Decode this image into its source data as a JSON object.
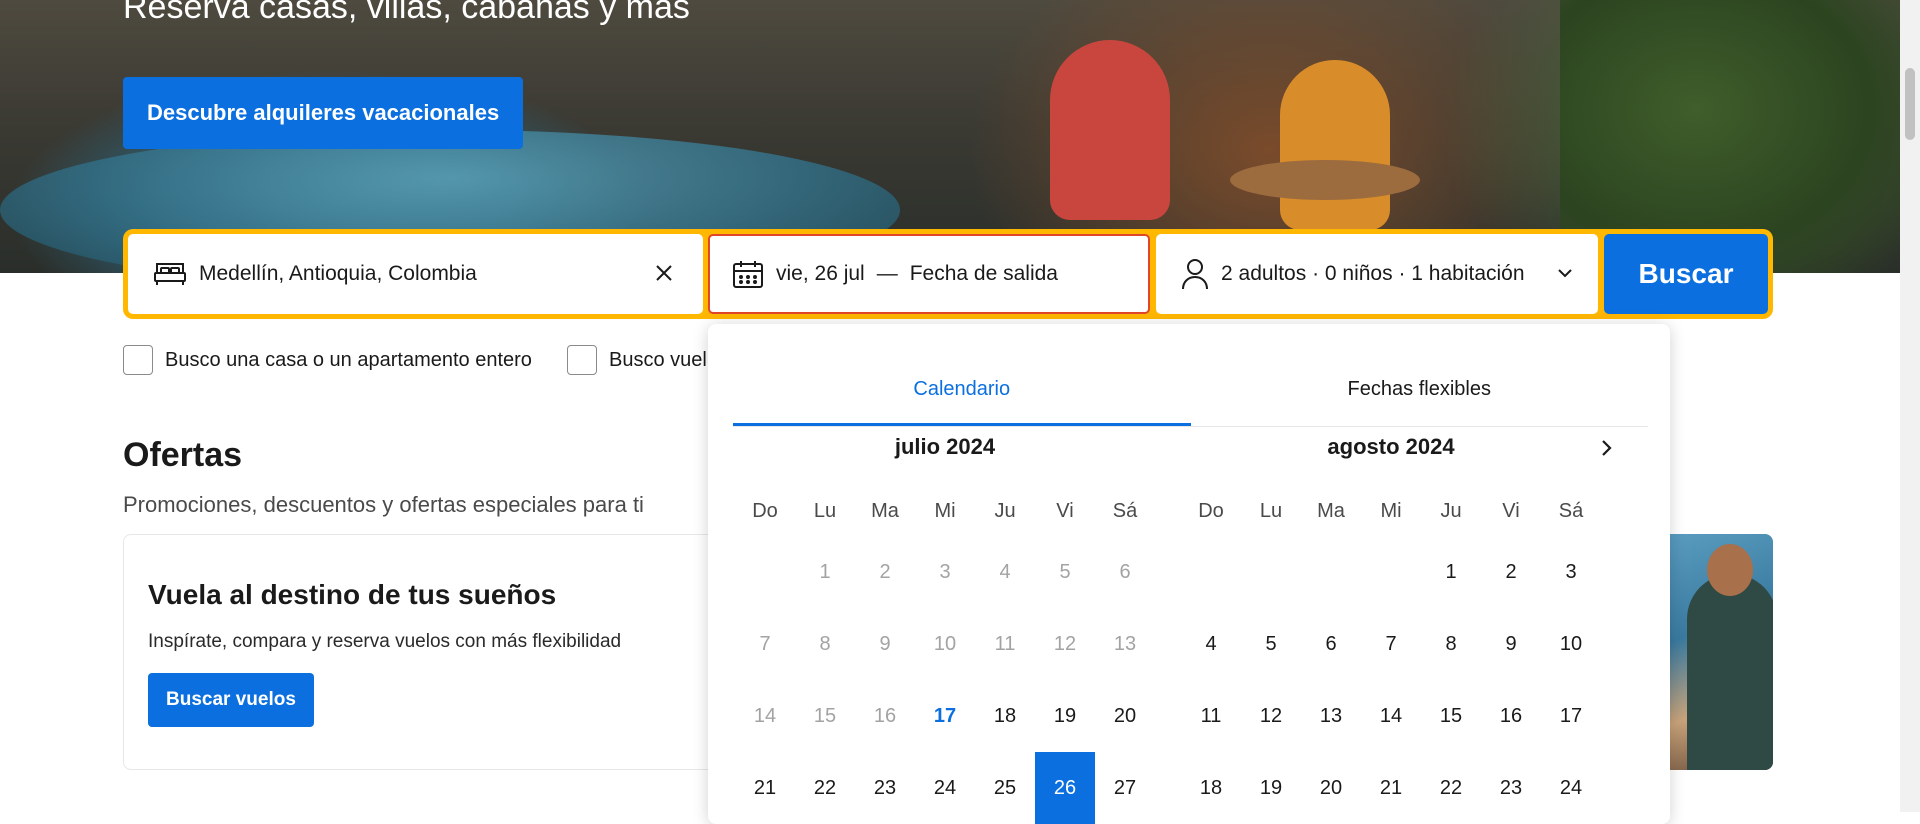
{
  "hero": {
    "title": "Reserva casas, villas, cabañas y más",
    "cta_label": "Descubre alquileres vacacionales"
  },
  "search": {
    "destination": "Medellín, Antioquia, Colombia",
    "checkin": "vie, 26 jul",
    "separator": "—",
    "checkout": "Fecha de salida",
    "guests": "2 adultos · 0 niños · 1 habitación",
    "button_label": "Buscar",
    "icons": {
      "bed": "bed-icon",
      "clear": "close-icon",
      "calendar": "calendar-icon",
      "person": "person-icon",
      "chevron": "chevron-down-icon"
    }
  },
  "filters": [
    {
      "label": "Busco una casa o un apartamento entero",
      "checked": false
    },
    {
      "label": "Busco vuel",
      "checked": false
    }
  ],
  "offers": {
    "title": "Ofertas",
    "subtitle": "Promociones, descuentos y ofertas especiales para ti",
    "card": {
      "title": "Vuela al destino de tus sueños",
      "description": "Inspírate, compara y reserva vuelos con más flexibilidad",
      "button_label": "Buscar vuelos"
    }
  },
  "calendar": {
    "tabs": [
      {
        "label": "Calendario",
        "active": true
      },
      {
        "label": "Fechas flexibles",
        "active": false
      }
    ],
    "weekdays": [
      "Do",
      "Lu",
      "Ma",
      "Mi",
      "Ju",
      "Vi",
      "Sá"
    ],
    "months": [
      {
        "title": "julio 2024",
        "offset": 1,
        "days": [
          1,
          2,
          3,
          4,
          5,
          6,
          7,
          8,
          9,
          10,
          11,
          12,
          13,
          14,
          15,
          16,
          17,
          18,
          19,
          20,
          21,
          22,
          23,
          24,
          25,
          26,
          27
        ],
        "past_until": 16,
        "today": 17,
        "selected": 26
      },
      {
        "title": "agosto 2024",
        "offset": 4,
        "days": [
          1,
          2,
          3,
          4,
          5,
          6,
          7,
          8,
          9,
          10,
          11,
          12,
          13,
          14,
          15,
          16,
          17,
          18,
          19,
          20,
          21,
          22,
          23,
          24
        ],
        "past_until": 0,
        "today": 0,
        "selected": 0
      }
    ],
    "next_icon": "chevron-right-icon"
  },
  "colors": {
    "brand_blue": "#0b6fdf",
    "search_border": "#ffb700",
    "date_focus_border": "#e0472a"
  }
}
